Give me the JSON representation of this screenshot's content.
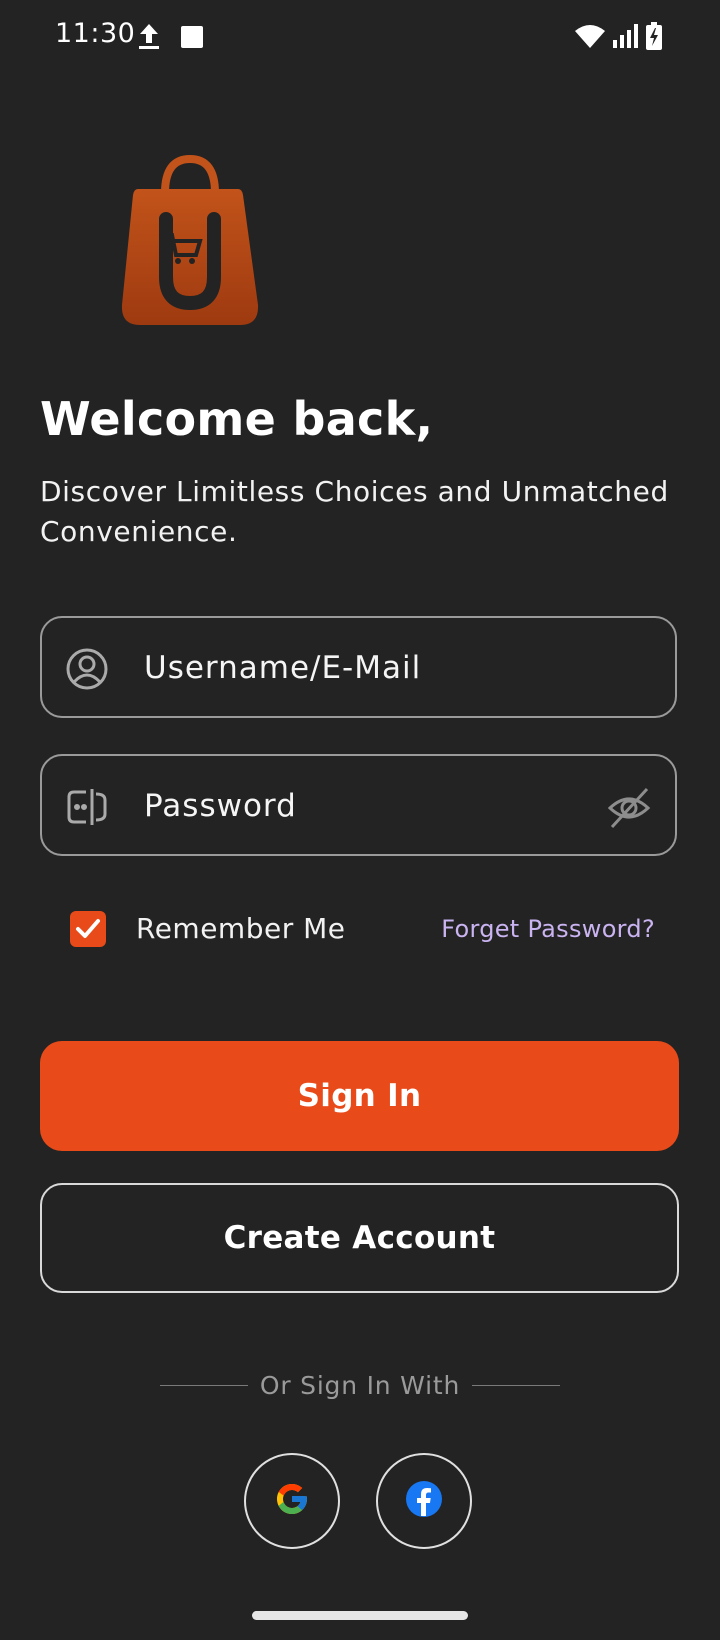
{
  "status_bar": {
    "time": "11:30",
    "icons": [
      "upload-icon",
      "stop-square-icon",
      "wifi-icon",
      "signal-icon",
      "battery-charging-icon"
    ]
  },
  "brand": {
    "logo": "shopping-bag-cart-logo",
    "accent_color": "#e84b19"
  },
  "header": {
    "title": "Welcome back,",
    "subtitle": "Discover Limitless Choices and Unmatched Convenience."
  },
  "form": {
    "username_placeholder": "Username/E-Mail",
    "password_placeholder": "Password",
    "remember_label": "Remember Me",
    "remember_checked": true,
    "forgot_label": "Forget Password?"
  },
  "actions": {
    "sign_in_label": "Sign In",
    "create_account_label": "Create Account"
  },
  "social": {
    "divider_text": "Or Sign In With",
    "providers": [
      "google-icon",
      "facebook-icon"
    ]
  },
  "colors": {
    "background": "#232323",
    "primary": "#e84b19",
    "link": "#c9b3f0"
  }
}
